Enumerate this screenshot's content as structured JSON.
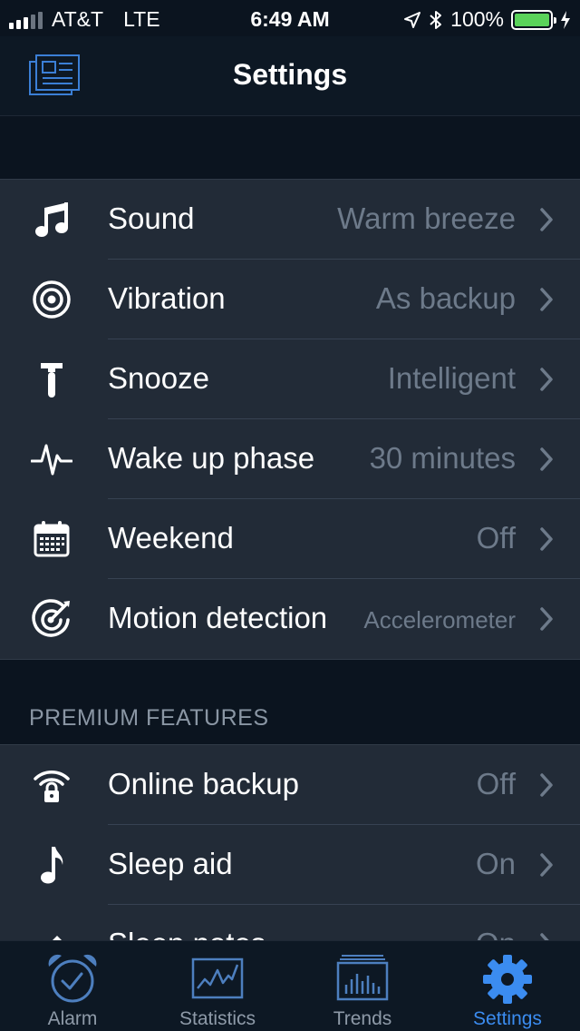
{
  "status_bar": {
    "carrier": "AT&T",
    "network": "LTE",
    "time": "6:49 AM",
    "battery": "100%",
    "battery_level": 1.0
  },
  "nav": {
    "title": "Settings",
    "left_icon": "news-icon"
  },
  "group1": [
    {
      "icon": "music-note-icon",
      "label": "Sound",
      "value": "Warm breeze"
    },
    {
      "icon": "vibration-icon",
      "label": "Vibration",
      "value": "As backup"
    },
    {
      "icon": "hammer-icon",
      "label": "Snooze",
      "value": "Intelligent"
    },
    {
      "icon": "pulse-icon",
      "label": "Wake up phase",
      "value": "30 minutes"
    },
    {
      "icon": "calendar-icon",
      "label": "Weekend",
      "value": "Off"
    },
    {
      "icon": "radar-icon",
      "label": "Motion detection",
      "value": "Accelerometer"
    }
  ],
  "premium_header": "PREMIUM FEATURES",
  "group2": [
    {
      "icon": "wifi-lock-icon",
      "label": "Online backup",
      "value": "Off"
    },
    {
      "icon": "eighth-note-icon",
      "label": "Sleep aid",
      "value": "On"
    },
    {
      "icon": "pencil-icon",
      "label": "Sleep notes",
      "value": "On"
    }
  ],
  "tabs": [
    {
      "icon": "alarm-clock-icon",
      "label": "Alarm"
    },
    {
      "icon": "statistics-chart-icon",
      "label": "Statistics"
    },
    {
      "icon": "trends-chart-icon",
      "label": "Trends"
    },
    {
      "icon": "gear-icon",
      "label": "Settings",
      "active": true
    }
  ],
  "colors": {
    "accent": "#3b8cf0",
    "background": "#0b141f",
    "cell": "#222b37",
    "value_text": "#6d7a8a",
    "battery": "#5ad35a"
  }
}
